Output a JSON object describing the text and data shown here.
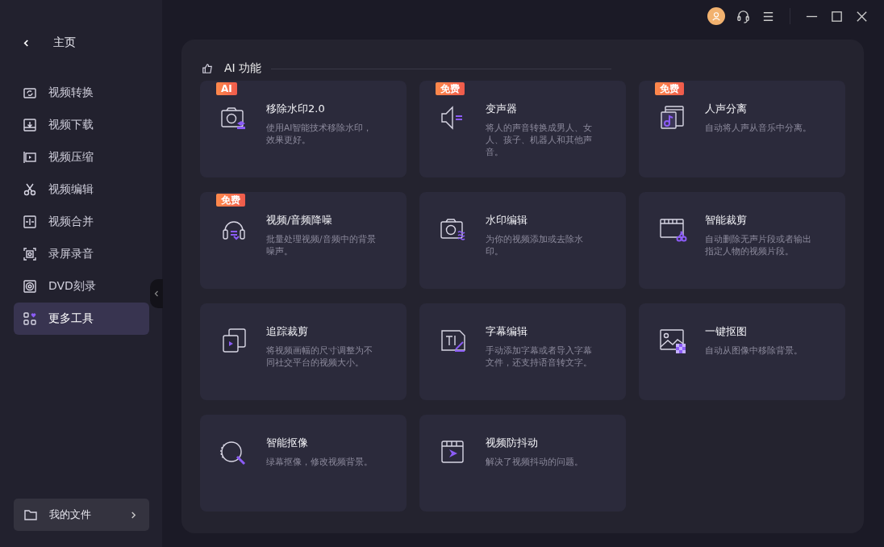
{
  "sidebar": {
    "back": {
      "label": "主页"
    },
    "items": [
      {
        "label": "视频转换",
        "selected": false
      },
      {
        "label": "视频下载",
        "selected": false
      },
      {
        "label": "视频压缩",
        "selected": false
      },
      {
        "label": "视频编辑",
        "selected": false
      },
      {
        "label": "视频合并",
        "selected": false
      },
      {
        "label": "录屏录音",
        "selected": false
      },
      {
        "label": "DVD刻录",
        "selected": false
      },
      {
        "label": "更多工具",
        "selected": true
      }
    ],
    "files_button": {
      "label": "我的文件"
    }
  },
  "section": {
    "title": "AI 功能",
    "cards": [
      {
        "title": "移除水印2.0",
        "description": "使用AI智能技术移除水印，效果更好。",
        "badge": "AI"
      },
      {
        "title": "变声器",
        "description": "将人的声音转换成男人、女人、孩子、机器人和其他声音。",
        "badge": "免费"
      },
      {
        "title": "人声分离",
        "description": "自动将人声从音乐中分离。",
        "badge": "免费"
      },
      {
        "title": "视频/音频降噪",
        "description": "批量处理视频/音频中的背景噪声。",
        "badge": "免费"
      },
      {
        "title": "水印编辑",
        "description": "为你的视频添加或去除水印。"
      },
      {
        "title": "智能裁剪",
        "description": "自动删除无声片段或者输出指定人物的视频片段。"
      },
      {
        "title": "追踪裁剪",
        "description": "将视频画幅的尺寸调整为不同社交平台的视频大小。"
      },
      {
        "title": "字幕编辑",
        "description": "手动添加字幕或者导入字幕文件，还支持语音转文字。"
      },
      {
        "title": "一键抠图",
        "description": "自动从图像中移除背景。"
      },
      {
        "title": "智能抠像",
        "description": "绿幕抠像，修改视频背景。"
      },
      {
        "title": "视频防抖动",
        "description": "解决了视频抖动的问题。"
      }
    ]
  }
}
